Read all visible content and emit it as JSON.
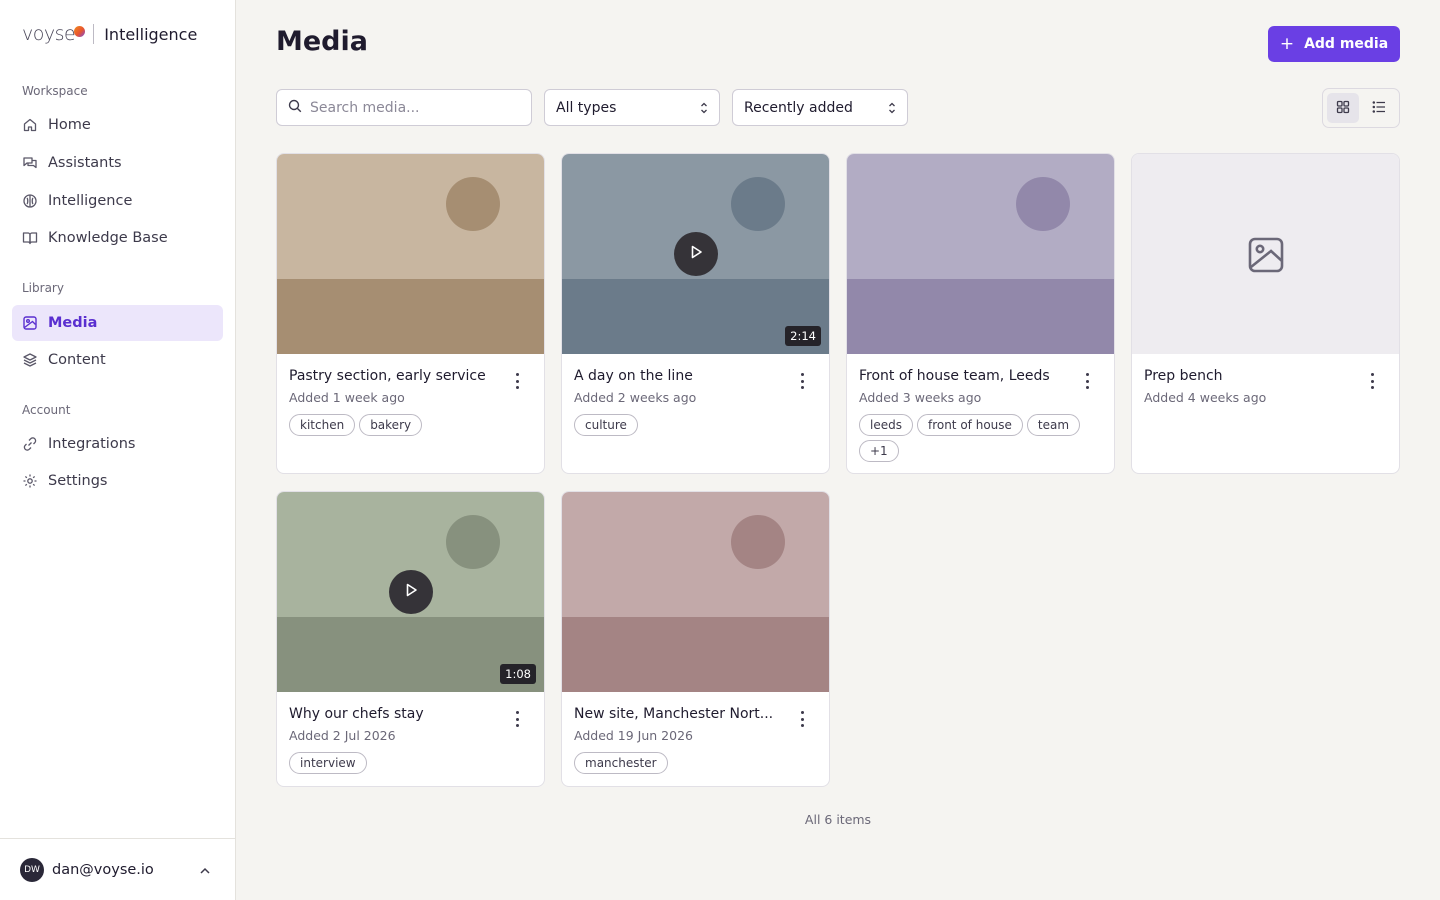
{
  "brand": {
    "name": "voyse",
    "product": "Intelligence"
  },
  "sidebar": {
    "groups": [
      {
        "label": "Workspace"
      },
      {
        "label": "Library"
      },
      {
        "label": "Account"
      }
    ],
    "items": [
      {
        "label": "Home",
        "icon": "home-icon"
      },
      {
        "label": "Assistants",
        "icon": "chat-icon"
      },
      {
        "label": "Intelligence",
        "icon": "brain-icon"
      },
      {
        "label": "Knowledge Base",
        "icon": "book-icon"
      },
      {
        "label": "Media",
        "icon": "image-icon",
        "active": true
      },
      {
        "label": "Content",
        "icon": "layers-icon"
      },
      {
        "label": "Integrations",
        "icon": "link-icon"
      },
      {
        "label": "Settings",
        "icon": "gear-icon"
      }
    ]
  },
  "account": {
    "initials": "DW",
    "email": "dan@voyse.io"
  },
  "header": {
    "title": "Media",
    "add_label": "Add media"
  },
  "filters": {
    "search_placeholder": "Search media...",
    "type": "All types",
    "sort": "Recently added"
  },
  "colors": {
    "accent": "#6a3fe4",
    "active_bg": "#ece6fb"
  },
  "media": [
    {
      "title": "Pastry section, early service",
      "date": "Added 1 week ago",
      "tags": [
        "kitchen",
        "bakery"
      ],
      "kind": "image",
      "palette": {
        "sky": "#c8b6a0",
        "ground": "#a68e72",
        "sun": "#a68e72"
      }
    },
    {
      "title": "A day on the line",
      "date": "Added 2 weeks ago",
      "tags": [
        "culture"
      ],
      "kind": "video",
      "duration": "2:14",
      "palette": {
        "sky": "#8b98a3",
        "ground": "#6b7b8a",
        "sun": "#6b7b8a"
      }
    },
    {
      "title": "Front of house team, Leeds",
      "date": "Added 3 weeks ago",
      "tags": [
        "leeds",
        "front of house",
        "team",
        "+1"
      ],
      "kind": "image",
      "palette": {
        "sky": "#b2acc4",
        "ground": "#9288aa",
        "sun": "#9288aa"
      }
    },
    {
      "title": "Prep bench",
      "date": "Added 4 weeks ago",
      "tags": [],
      "kind": "placeholder",
      "palette": {
        "sky": "#eeecf0",
        "ground": "#eeecf0",
        "sun": "#eeecf0"
      }
    },
    {
      "title": "Why our chefs stay",
      "date": "Added 2 Jul 2026",
      "tags": [
        "interview"
      ],
      "kind": "video",
      "duration": "1:08",
      "palette": {
        "sky": "#a8b39e",
        "ground": "#87917e",
        "sun": "#87917e"
      }
    },
    {
      "title": "New site, Manchester Nort...",
      "date": "Added 19 Jun 2026",
      "tags": [
        "manchester"
      ],
      "kind": "image",
      "palette": {
        "sky": "#c2a9a9",
        "ground": "#a48484",
        "sun": "#a48484"
      }
    }
  ],
  "footer": {
    "count_label": "All 6 items"
  }
}
